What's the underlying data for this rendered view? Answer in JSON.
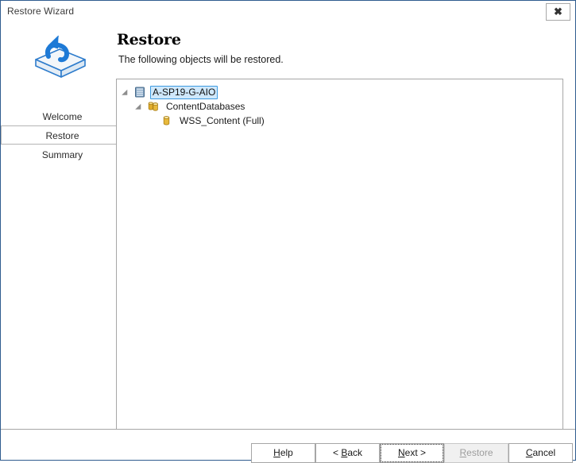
{
  "window": {
    "title": "Restore Wizard",
    "close_label": "✖",
    "close_icon": "close-icon",
    "border_color": "#2f5c8f"
  },
  "sidebar": {
    "wizard_icon": "restore-arrow-box-icon",
    "items": [
      {
        "label": "Welcome",
        "active": false
      },
      {
        "label": "Restore",
        "active": true
      },
      {
        "label": "Summary",
        "active": false
      }
    ]
  },
  "header": {
    "title": "Restore",
    "subtitle": "The following objects will be restored."
  },
  "tree": {
    "nodes": [
      {
        "label": "A-SP19-G-AIO",
        "level": 0,
        "icon": "server-icon",
        "expanded": true,
        "selected": true
      },
      {
        "label": "ContentDatabases",
        "level": 1,
        "icon": "databases-icon",
        "expanded": true,
        "selected": false
      },
      {
        "label": "WSS_Content (Full)",
        "level": 2,
        "icon": "database-icon",
        "expanded": false,
        "selected": false
      }
    ]
  },
  "buttons": {
    "help": {
      "prefix": "",
      "accel": "H",
      "suffix": "elp",
      "disabled": false,
      "focused": false
    },
    "back": {
      "prefix": "< ",
      "accel": "B",
      "suffix": "ack",
      "disabled": false,
      "focused": false
    },
    "next": {
      "prefix": "",
      "accel": "N",
      "suffix": "ext >",
      "disabled": false,
      "focused": true
    },
    "restore": {
      "prefix": "",
      "accel": "R",
      "suffix": "estore",
      "disabled": true,
      "focused": false
    },
    "cancel": {
      "prefix": "",
      "accel": "C",
      "suffix": "ancel",
      "disabled": false,
      "focused": false
    }
  },
  "colors": {
    "accent": "#3c9ae0",
    "selection_fill": "#cfe8fb",
    "panel_border": "#a6a6a6",
    "db_icon": "#e8b93c",
    "server_icon": "#5b86ad"
  }
}
